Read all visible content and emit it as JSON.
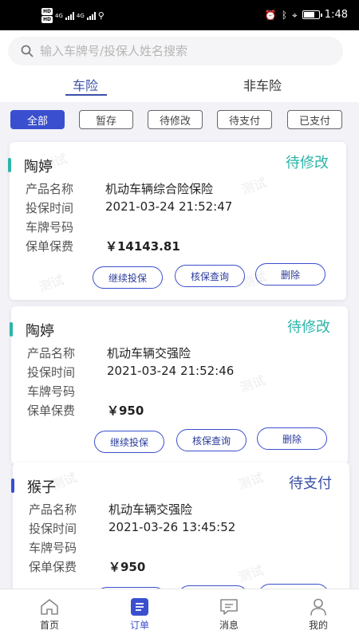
{
  "status_bar": {
    "left_badges": [
      "HD",
      "HD"
    ],
    "net_labels": [
      "4G",
      "4G"
    ],
    "time": "1:48",
    "battery_level": 0.8,
    "icons": [
      "alarm-icon",
      "bluetooth-icon",
      "location-icon",
      "battery-icon",
      "usb-icon"
    ]
  },
  "search": {
    "placeholder": "输入车牌号/投保人姓名搜索"
  },
  "tabs": [
    {
      "label": "车险",
      "active": true
    },
    {
      "label": "非车险",
      "active": false
    }
  ],
  "filters": [
    {
      "label": "全部",
      "active": true
    },
    {
      "label": "暂存",
      "active": false
    },
    {
      "label": "待修改",
      "active": false
    },
    {
      "label": "待支付",
      "active": false
    },
    {
      "label": "已支付",
      "active": false
    }
  ],
  "field_labels": {
    "product": "产品名称",
    "time": "投保时间",
    "plate": "车牌号码",
    "premium": "保单保费"
  },
  "orders": [
    {
      "name": "陶婷",
      "status": "待修改",
      "status_color": "#2bb5a8",
      "bar_color": "#2bb5a8",
      "product": "机动车辆综合险保险",
      "time": "2021-03-24 21:52:47",
      "plate": "",
      "premium": "￥14143.81",
      "buttons": [
        "继续投保",
        "核保查询",
        "删除"
      ]
    },
    {
      "name": "陶婷",
      "status": "待修改",
      "status_color": "#2bb5a8",
      "bar_color": "#2bb5a8",
      "product": "机动车辆交强险",
      "time": "2021-03-24 21:52:46",
      "plate": "",
      "premium": "￥950",
      "buttons": [
        "继续投保",
        "核保查询",
        "删除"
      ]
    },
    {
      "name": "猴子",
      "status": "待支付",
      "status_color": "#3a4fa8",
      "bar_color": "#3a4fcf",
      "product": "机动车辆交强险",
      "time": "2021-03-26 13:45:52",
      "plate": "",
      "premium": "￥950",
      "buttons": [
        "",
        "",
        ""
      ]
    }
  ],
  "watermark_text": "测试",
  "bottom_nav": [
    {
      "label": "首页",
      "icon": "home-icon",
      "active": false
    },
    {
      "label": "订单",
      "icon": "orders-icon",
      "active": true
    },
    {
      "label": "消息",
      "icon": "message-icon",
      "active": false
    },
    {
      "label": "我的",
      "icon": "profile-icon",
      "active": false
    }
  ],
  "colors": {
    "accent": "#3a4fcf",
    "accent_dark": "#3b4fa8",
    "teal": "#2bb5a8"
  }
}
